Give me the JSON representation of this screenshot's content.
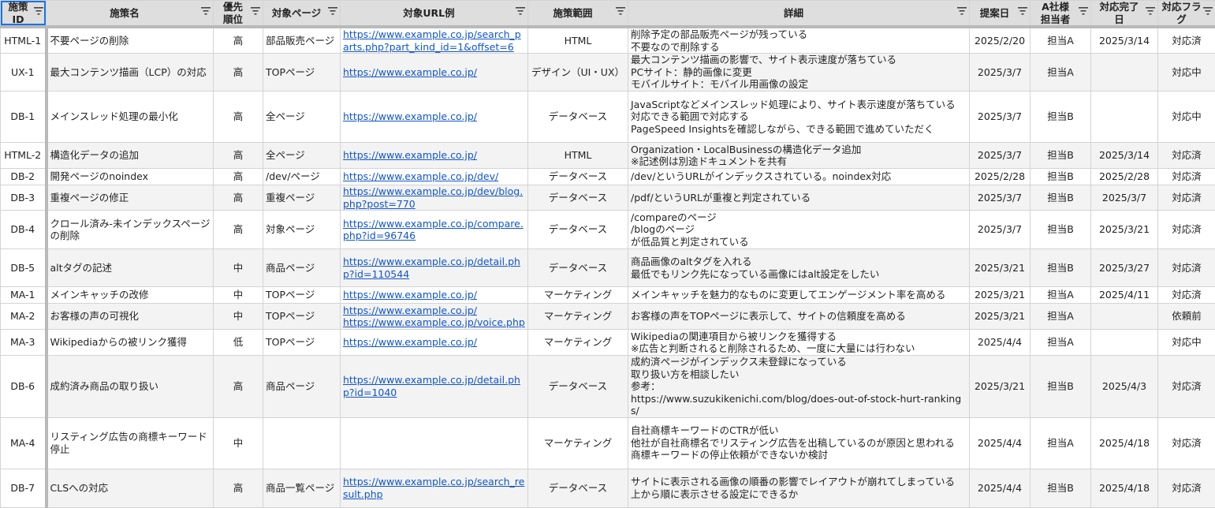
{
  "headers": [
    "施策\nID",
    "施策名",
    "優先\n順位",
    "対象ページ",
    "対象URL例",
    "施策範囲",
    "詳細",
    "提案日",
    "A社様\n担当者",
    "対応完了\n日",
    "対応フラ\nグ"
  ],
  "rows": [
    {
      "id": "HTML-1",
      "name": "不要ページの削除",
      "priority": "高",
      "page": "部品販売ページ",
      "urls": [
        "https://www.example.co.jp/search_parts.php?part_kind_id=1&offset=6"
      ],
      "scope": "HTML",
      "detail": "削除予定の部品販売ページが残っている\n不要なので削除する",
      "proposed": "2025/2/20",
      "owner": "担当A",
      "done": "2025/3/14",
      "flag": "対応済"
    },
    {
      "id": "UX-1",
      "name": "最大コンテンツ描画（LCP）の対応",
      "priority": "高",
      "page": "TOPページ",
      "urls": [
        "https://www.example.co.jp/"
      ],
      "scope": "デザイン（UI・UX）",
      "detail": "最大コンテンツ描画の影響で、サイト表示速度が落ちている\nPCサイト：静的画像に変更\nモバイルサイト：モバイル用画像の設定",
      "proposed": "2025/3/7",
      "owner": "担当A",
      "done": "",
      "flag": "対応中"
    },
    {
      "id": "DB-1",
      "name": "メインスレッド処理の最小化",
      "priority": "高",
      "page": "全ページ",
      "urls": [
        "https://www.example.co.jp/"
      ],
      "scope": "データベース",
      "detail": "JavaScriptなどメインスレッド処理により、サイト表示速度が落ちている\n対応できる範囲で対応する\nPageSpeed Insightsを確認しながら、できる範囲で進めていただく",
      "proposed": "2025/3/7",
      "owner": "担当B",
      "done": "",
      "flag": "対応中"
    },
    {
      "id": "HTML-2",
      "name": "構造化データの追加",
      "priority": "高",
      "page": "全ページ",
      "urls": [
        "https://www.example.co.jp/"
      ],
      "scope": "HTML",
      "detail": "Organization・LocalBusinessの構造化データ追加\n※記述例は別途ドキュメントを共有",
      "proposed": "2025/3/7",
      "owner": "担当B",
      "done": "2025/3/14",
      "flag": "対応済"
    },
    {
      "id": "DB-2",
      "name": "開発ページのnoindex",
      "priority": "高",
      "page": "/dev/ページ",
      "urls": [
        "https://www.example.co.jp/dev/"
      ],
      "scope": "データベース",
      "detail": "/dev/というURLがインデックスされている。noindex対応",
      "proposed": "2025/2/28",
      "owner": "担当B",
      "done": "2025/2/28",
      "flag": "対応済"
    },
    {
      "id": "DB-3",
      "name": "重複ページの修正",
      "priority": "高",
      "page": "重複ページ",
      "urls": [
        "https://www.example.co.jp/dev/blog.php?post=770"
      ],
      "scope": "データベース",
      "detail": "/pdf/というURLが重複と判定されている",
      "proposed": "2025/3/7",
      "owner": "担当B",
      "done": "2025/3/7",
      "flag": "対応済"
    },
    {
      "id": "DB-4",
      "name": "クロール済み-未インデックスページの削除",
      "priority": "高",
      "page": "対象ページ",
      "urls": [
        "https://www.example.co.jp/compare.php?id=96746"
      ],
      "scope": "データベース",
      "detail": "/compareのページ\n/blogのページ\nが低品質と判定されている",
      "proposed": "2025/3/7",
      "owner": "担当B",
      "done": "2025/3/21",
      "flag": "対応済"
    },
    {
      "id": "DB-5",
      "name": "altタグの記述",
      "priority": "中",
      "page": "商品ページ",
      "urls": [
        "https://www.example.co.jp/detail.php?id=110544"
      ],
      "scope": "データベース",
      "detail": "商品画像のaltタグを入れる\n最低でもリンク先になっている画像にはalt設定をしたい",
      "proposed": "2025/3/21",
      "owner": "担当B",
      "done": "2025/3/27",
      "flag": "対応済"
    },
    {
      "id": "MA-1",
      "name": "メインキャッチの改修",
      "priority": "中",
      "page": "TOPページ",
      "urls": [
        "https://www.example.co.jp/"
      ],
      "scope": "マーケティング",
      "detail": "メインキャッチを魅力的なものに変更してエンゲージメント率を高める",
      "proposed": "2025/3/21",
      "owner": "担当A",
      "done": "2025/4/11",
      "flag": "対応済"
    },
    {
      "id": "MA-2",
      "name": "お客様の声の可視化",
      "priority": "中",
      "page": "TOPページ",
      "urls": [
        "https://www.example.co.jp/",
        "https://www.example.co.jp/voice.php"
      ],
      "scope": "マーケティング",
      "detail": "お客様の声をTOPページに表示して、サイトの信頼度を高める",
      "proposed": "2025/3/21",
      "owner": "担当A",
      "done": "",
      "flag": "依頼前"
    },
    {
      "id": "MA-3",
      "name": "Wikipediaからの被リンク獲得",
      "priority": "低",
      "page": "TOPページ",
      "urls": [
        "https://www.example.co.jp/"
      ],
      "scope": "マーケティング",
      "detail": "Wikipediaの関連項目から被リンクを獲得する\n※広告と判断されると削除されるため、一度に大量には行わない",
      "proposed": "2025/4/4",
      "owner": "担当A",
      "done": "",
      "flag": "対応中"
    },
    {
      "id": "DB-6",
      "name": "成約済み商品の取り扱い",
      "priority": "高",
      "page": "商品ページ",
      "urls": [
        "https://www.example.co.jp/detail.php?id=1040"
      ],
      "scope": "データベース",
      "detail": "成約済ページがインデックス未登録になっている\n取り扱い方を相談したい\n参考：\nhttps://www.suzukikenichi.com/blog/does-out-of-stock-hurt-rankings/",
      "proposed": "2025/3/21",
      "owner": "担当B",
      "done": "2025/4/3",
      "flag": "対応済"
    },
    {
      "id": "MA-4",
      "name": "リスティング広告の商標キーワード停止",
      "priority": "中",
      "page": "",
      "urls": [],
      "scope": "マーケティング",
      "detail": "自社商標キーワードのCTRが低い\n他社が自社商標名でリスティング広告を出稿しているのが原因と思われる\n商標キーワードの停止依頼ができないか検討",
      "proposed": "2025/4/4",
      "owner": "担当A",
      "done": "2025/4/18",
      "flag": "対応済"
    },
    {
      "id": "DB-7",
      "name": "CLSへの対応",
      "priority": "高",
      "page": "商品一覧ページ",
      "urls": [
        "https://www.example.co.jp/search_result.php"
      ],
      "scope": "データベース",
      "detail": "サイトに表示される画像の順番の影響でレイアウトが崩れてしまっている\n上から順に表示させる設定にできるか",
      "proposed": "2025/4/4",
      "owner": "担当B",
      "done": "2025/4/18",
      "flag": "対応済"
    }
  ]
}
